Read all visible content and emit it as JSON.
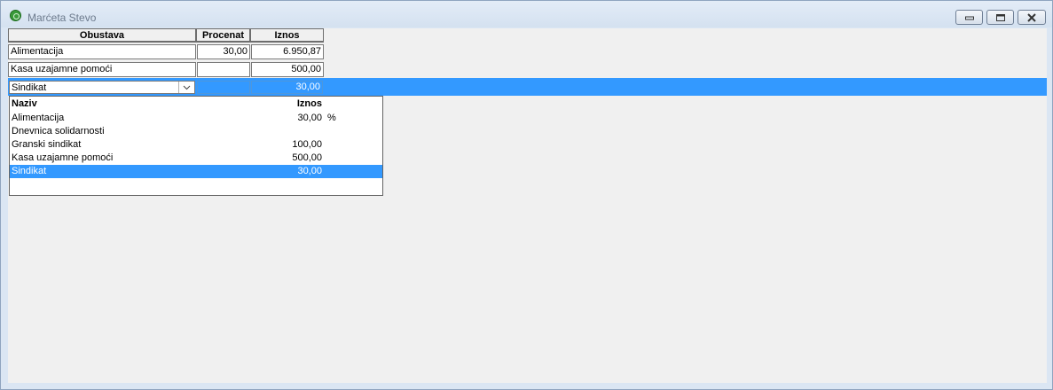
{
  "window": {
    "title": "Marćeta Stevo",
    "colors": {
      "titlebar": "#d4e1f0",
      "selection": "#3399ff"
    }
  },
  "grid": {
    "headers": [
      "Obustava",
      "Procenat",
      "Iznos"
    ],
    "rows": [
      {
        "obustava": "Alimentacija",
        "procenat": "30,00",
        "iznos": "6.950,87"
      },
      {
        "obustava": "Kasa uzajamne pomoći",
        "procenat": "",
        "iznos": "500,00"
      },
      {
        "obustava": "Sindikat",
        "procenat": "",
        "iznos": "30,00",
        "selected": true
      }
    ]
  },
  "dropdown": {
    "headers": {
      "naziv": "Naziv",
      "iznos": "Iznos"
    },
    "items": [
      {
        "naziv": "Alimentacija",
        "iznos": "30,00",
        "unit": "%"
      },
      {
        "naziv": "Dnevnica solidarnosti",
        "iznos": "",
        "unit": ""
      },
      {
        "naziv": "Granski sindikat",
        "iznos": "100,00",
        "unit": ""
      },
      {
        "naziv": "Kasa uzajamne pomoći",
        "iznos": "500,00",
        "unit": ""
      },
      {
        "naziv": "Sindikat",
        "iznos": "30,00",
        "unit": "",
        "selected": true
      }
    ]
  },
  "icons": [
    "app-icon",
    "minimize-icon",
    "restore-icon",
    "close-icon",
    "chevron-down-icon"
  ]
}
